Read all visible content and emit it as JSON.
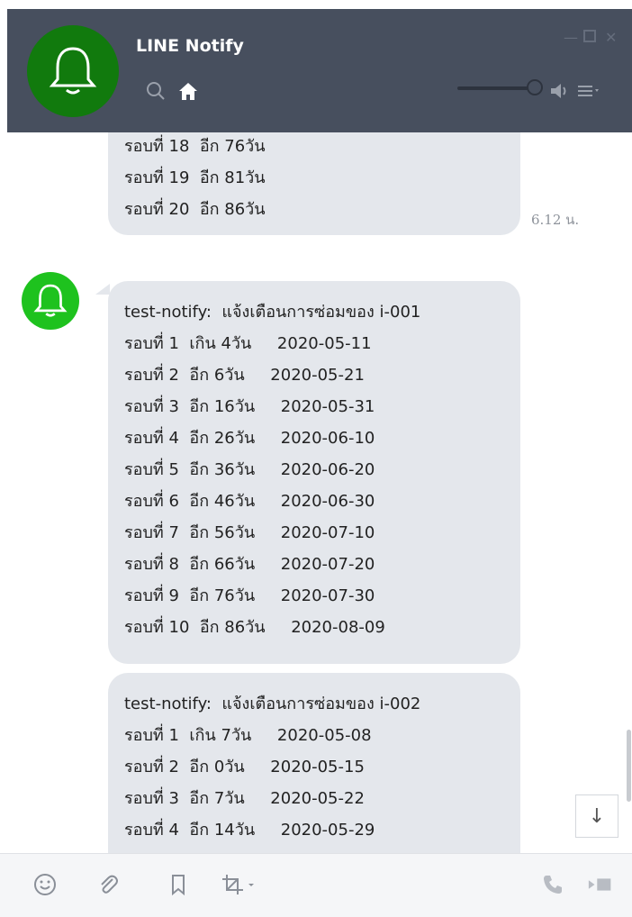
{
  "header": {
    "title": "LINE Notify",
    "icons": [
      "bell-icon",
      "search-icon",
      "home-icon",
      "volume-icon",
      "menu-icon",
      "minimize-icon",
      "maximize-icon",
      "close-icon"
    ]
  },
  "messages": {
    "first_bubble": [
      "รอบที่ 18  อีก 76วัน",
      "รอบที่ 19  อีก 81วัน",
      "รอบที่ 20  อีก 86วัน"
    ],
    "first_time": "6.12 น.",
    "second_bubble": [
      "test-notify:  แจ้งเตือนการซ่อมของ i-001",
      "รอบที่ 1  เกิน 4วัน     2020-05-11",
      "รอบที่ 2  อีก 6วัน     2020-05-21",
      "รอบที่ 3  อีก 16วัน     2020-05-31",
      "รอบที่ 4  อีก 26วัน     2020-06-10",
      "รอบที่ 5  อีก 36วัน     2020-06-20",
      "รอบที่ 6  อีก 46วัน     2020-06-30",
      "รอบที่ 7  อีก 56วัน     2020-07-10",
      "รอบที่ 8  อีก 66วัน     2020-07-20",
      "รอบที่ 9  อีก 76วัน     2020-07-30",
      "รอบที่ 10  อีก 86วัน     2020-08-09"
    ],
    "third_bubble": [
      "test-notify:  แจ้งเตือนการซ่อมของ i-002",
      "รอบที่ 1  เกิน 7วัน     2020-05-08",
      "รอบที่ 2  อีก 0วัน     2020-05-15",
      "รอบที่ 3  อีก 7วัน     2020-05-22",
      "รอบที่ 4  อีก 14วัน     2020-05-29"
    ]
  },
  "toolbar": {
    "icons": [
      "emoji-icon",
      "attach-icon",
      "bookmark-icon",
      "crop-icon",
      "call-icon",
      "send-icon"
    ]
  },
  "colors": {
    "header_bg": "#474f5e",
    "bubble_bg": "#e4e7ec",
    "line_green": "#1ec21e"
  }
}
